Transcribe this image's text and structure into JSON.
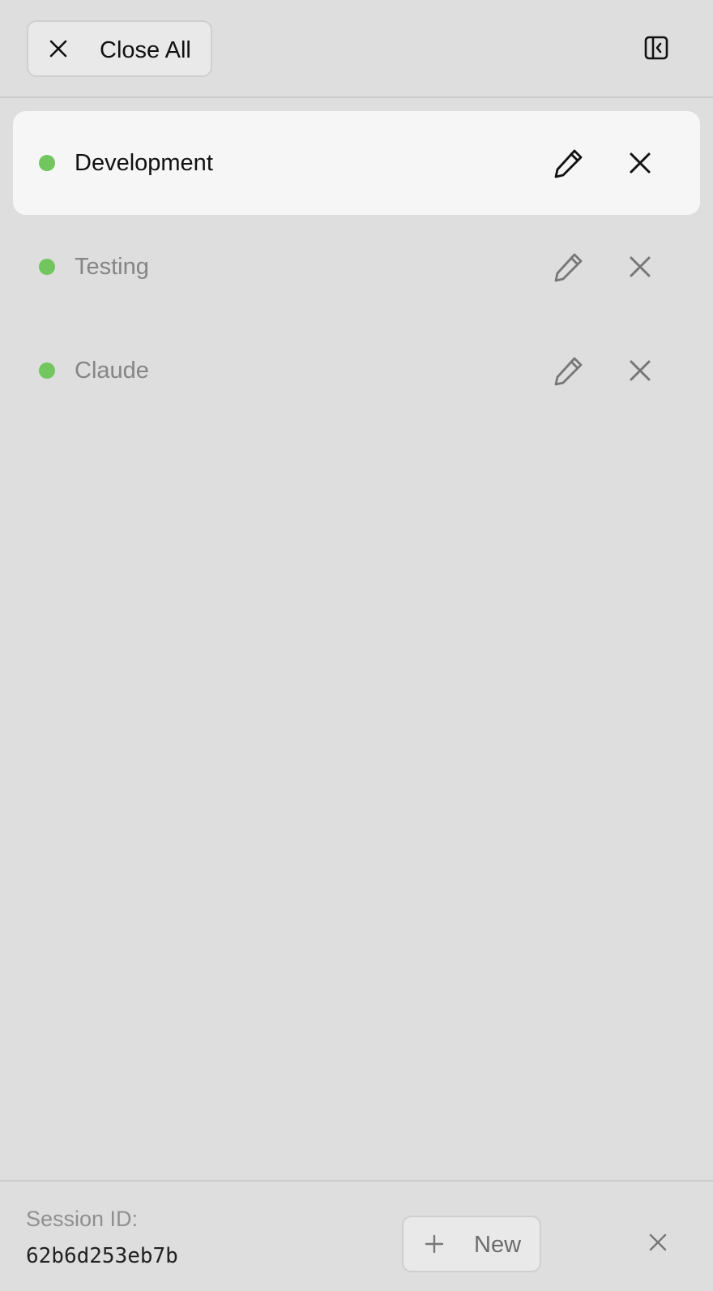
{
  "header": {
    "close_all_label": "Close All",
    "close_all_icon": "close-icon",
    "panel_toggle_icon": "sidebar-collapse-icon"
  },
  "sessions": [
    {
      "name": "Development",
      "status_color": "#72c55f",
      "active": true
    },
    {
      "name": "Testing",
      "status_color": "#72c55f",
      "active": false
    },
    {
      "name": "Claude",
      "status_color": "#72c55f",
      "active": false
    }
  ],
  "footer": {
    "session_id_label": "Session ID:",
    "session_id_value": "62b6d253eb7b",
    "new_label": "New",
    "new_icon": "plus-icon",
    "close_icon": "close-icon"
  },
  "colors": {
    "background": "#dedede",
    "active_row": "#f6f6f6",
    "status_green": "#72c55f"
  }
}
